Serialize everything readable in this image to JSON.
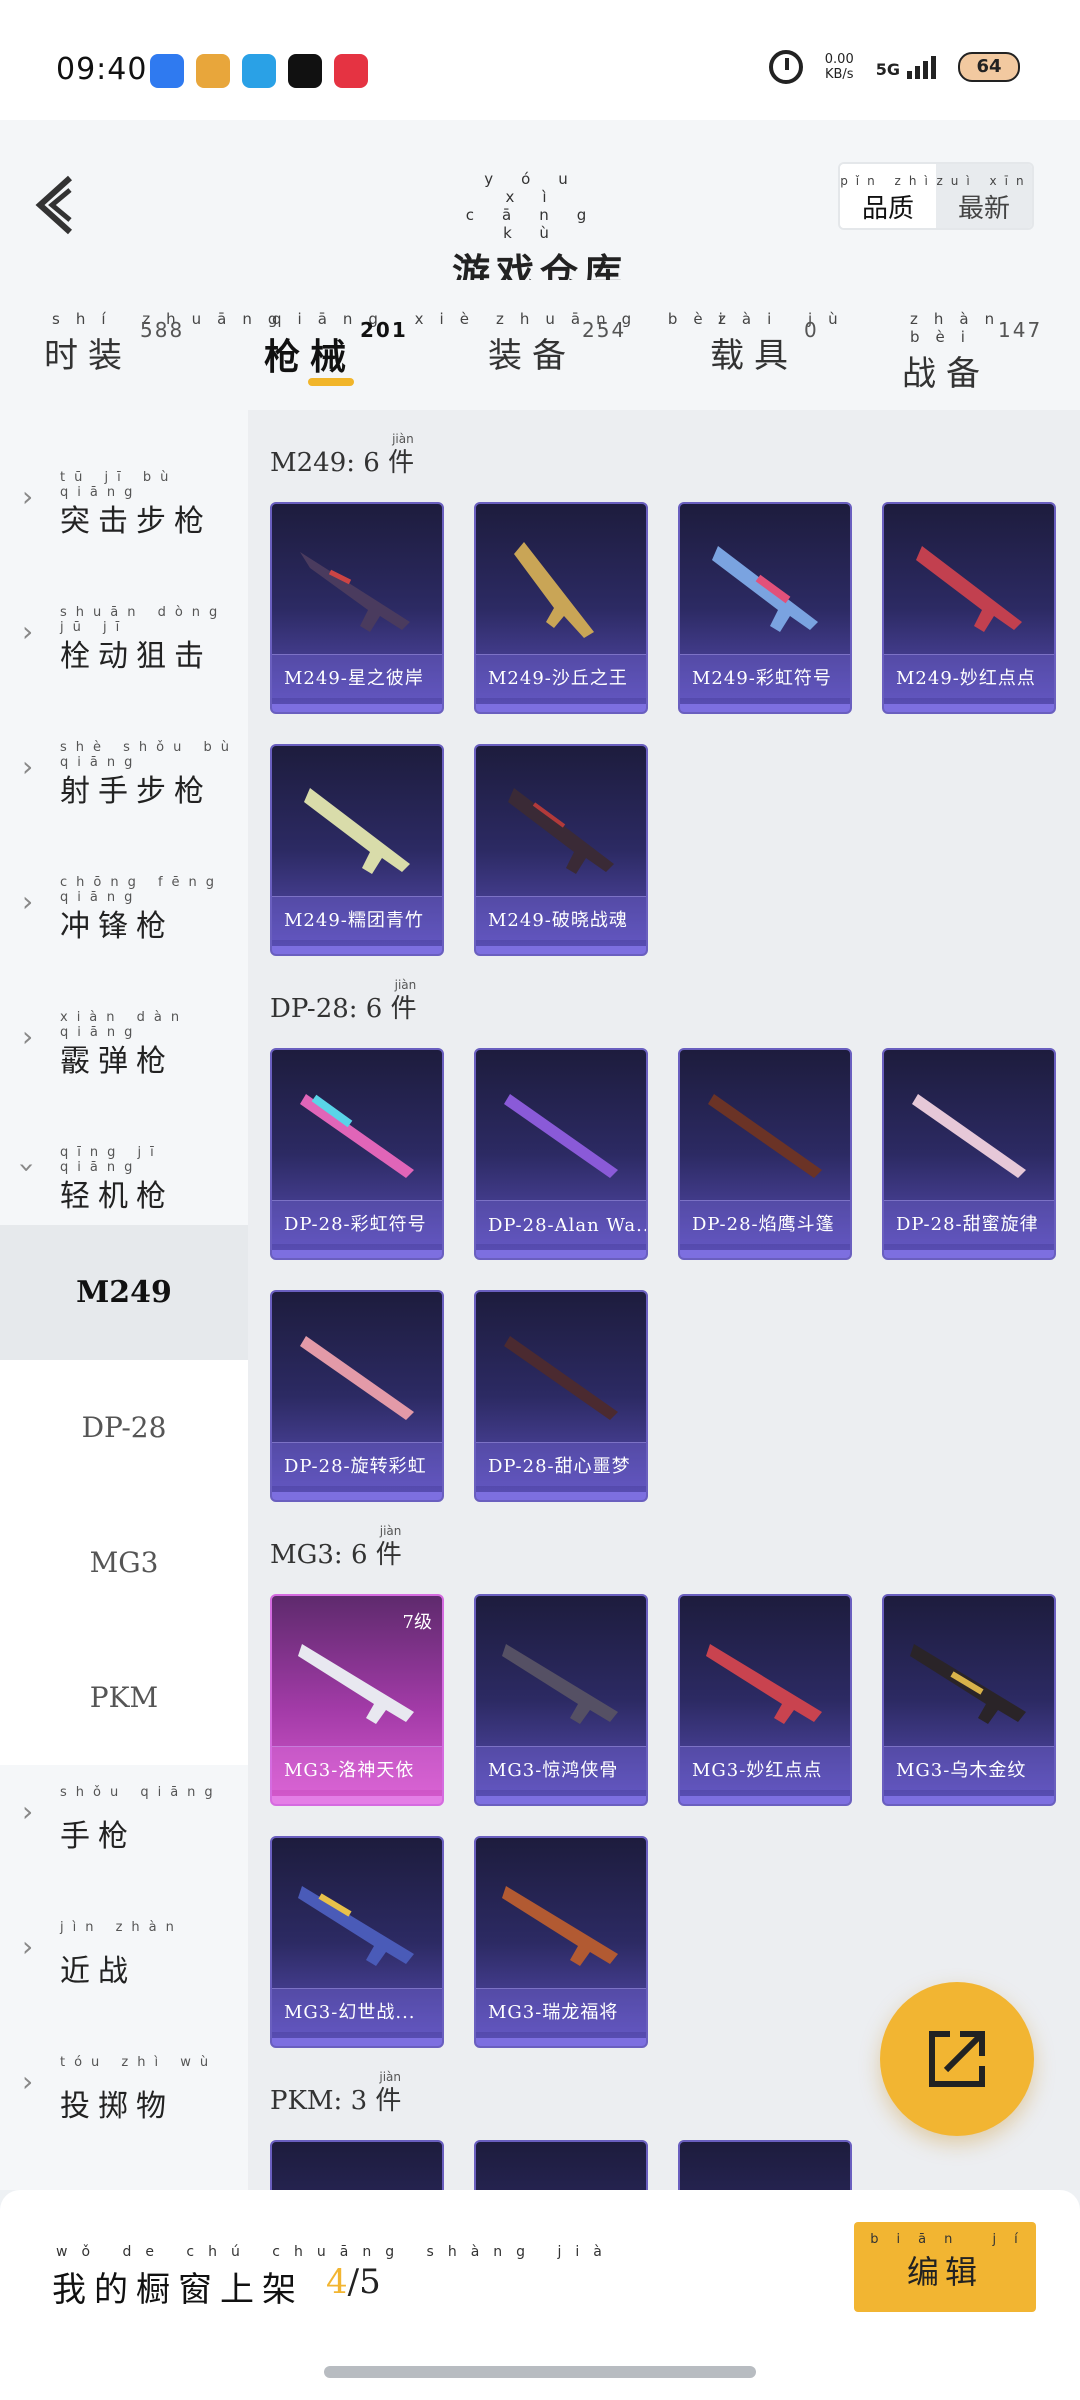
{
  "status_bar": {
    "time": "09:40",
    "net_speed_value": "0.00",
    "net_speed_unit": "KB/s",
    "network": "5G",
    "battery": "64",
    "app_icon_colors": [
      "#2f7af0",
      "#e8a63b",
      "#2aa1e6",
      "#111111",
      "#e53342"
    ]
  },
  "header": {
    "title": "游戏仓库",
    "title_pinyin": "yóu xì cāng kù",
    "sort_options": [
      {
        "label": "品质",
        "pinyin": "pǐn zhì"
      },
      {
        "label": "最新",
        "pinyin": "zuì xīn"
      }
    ]
  },
  "tabs": [
    {
      "label": "时装",
      "pinyin": "shí zhuāng",
      "count": "588"
    },
    {
      "label": "枪械",
      "pinyin": "qiāng xiè",
      "count": "201"
    },
    {
      "label": "装备",
      "pinyin": "zhuāng bèi",
      "count": "254"
    },
    {
      "label": "载具",
      "pinyin": "zài jù",
      "count": "0"
    },
    {
      "label": "战备",
      "pinyin": "zhàn bèi",
      "count": "147"
    }
  ],
  "sidebar": {
    "categories": [
      {
        "label": "突击步枪",
        "pinyin": "tū jī bù qiāng"
      },
      {
        "label": "栓动狙击",
        "pinyin": "shuān dòng jū jī"
      },
      {
        "label": "射手步枪",
        "pinyin": "shè shǒu bù qiāng"
      },
      {
        "label": "冲锋枪",
        "pinyin": "chōng fēng qiāng"
      },
      {
        "label": "霰弹枪",
        "pinyin": "xiàn dàn qiāng"
      },
      {
        "label": "轻机枪",
        "pinyin": "qīng jī qiāng"
      }
    ],
    "subitems": [
      "M249",
      "DP-28",
      "MG3",
      "PKM"
    ],
    "more_categories": [
      {
        "label": "手枪",
        "pinyin": "shǒu qiāng"
      },
      {
        "label": "近战",
        "pinyin": "jìn zhàn"
      },
      {
        "label": "投掷物",
        "pinyin": "tóu zhì wù"
      }
    ]
  },
  "groups": [
    {
      "title": "M249: 6",
      "unit": "件",
      "unit_pinyin": "jiàn",
      "items": [
        "M249-星之彼岸",
        "M249-沙丘之王",
        "M249-彩虹符号",
        "M249-妙红点点",
        "M249-糯团青竹",
        "M249-破晓战魂"
      ]
    },
    {
      "title": "DP-28: 6",
      "unit": "件",
      "unit_pinyin": "jiàn",
      "items": [
        "DP-28-彩虹符号",
        "DP-28-Alan Wa...",
        "DP-28-焰鹰斗篷",
        "DP-28-甜蜜旋律",
        "DP-28-旋转彩虹",
        "DP-28-甜心噩梦"
      ]
    },
    {
      "title": "MG3: 6",
      "unit": "件",
      "unit_pinyin": "jiàn",
      "items": [
        "MG3-洛神天依",
        "MG3-惊鸿侠骨",
        "MG3-妙红点点",
        "MG3-乌木金纹",
        "MG3-幻世战...",
        "MG3-瑞龙福将"
      ],
      "first_item_level": "7级"
    },
    {
      "title": "PKM: 3",
      "unit": "件",
      "unit_pinyin": "jiàn",
      "items": [
        "",
        "",
        ""
      ]
    }
  ],
  "bottom": {
    "showcase_label": "我的橱窗上架",
    "showcase_pinyin": "wǒ de chú chuāng shàng jià",
    "showcase_current": "4",
    "showcase_total": "/5",
    "edit_label": "编辑",
    "edit_pinyin": "biān jí"
  },
  "colors": {
    "accent": "#f2b532",
    "card_border": "#6a5fbf",
    "card_special": "#d65acd"
  }
}
